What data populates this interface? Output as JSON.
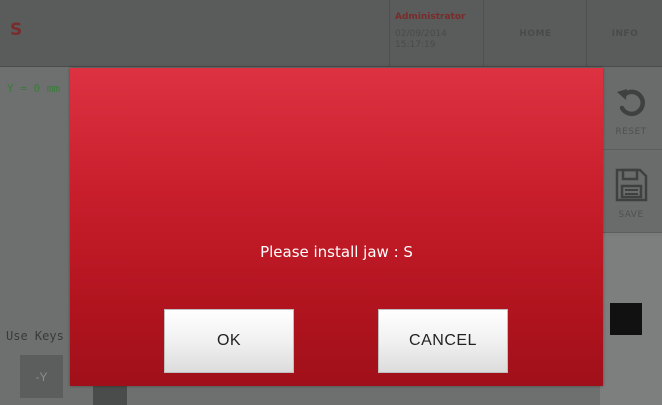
{
  "header": {
    "title": "S",
    "user": "Administrator",
    "date": "02/09/2014",
    "time": "15:17:19",
    "home_label": "HOME",
    "info_label": "INFO"
  },
  "main": {
    "y_readout": "Y = 0 mm",
    "use_keys_label": "Use Keys",
    "jog_minus_y_label": "-Y"
  },
  "side_panel": {
    "reset_label": "RESET",
    "reset_icon": "reset-icon",
    "save_label": "SAVE",
    "save_icon": "save-icon"
  },
  "dialog": {
    "message": "Please install jaw : S",
    "ok_label": "OK",
    "cancel_label": "CANCEL"
  },
  "colors": {
    "dialog_red": "#c81e2c",
    "dimmed_background": "#6f7170",
    "button_face": "#f1f1f1"
  }
}
